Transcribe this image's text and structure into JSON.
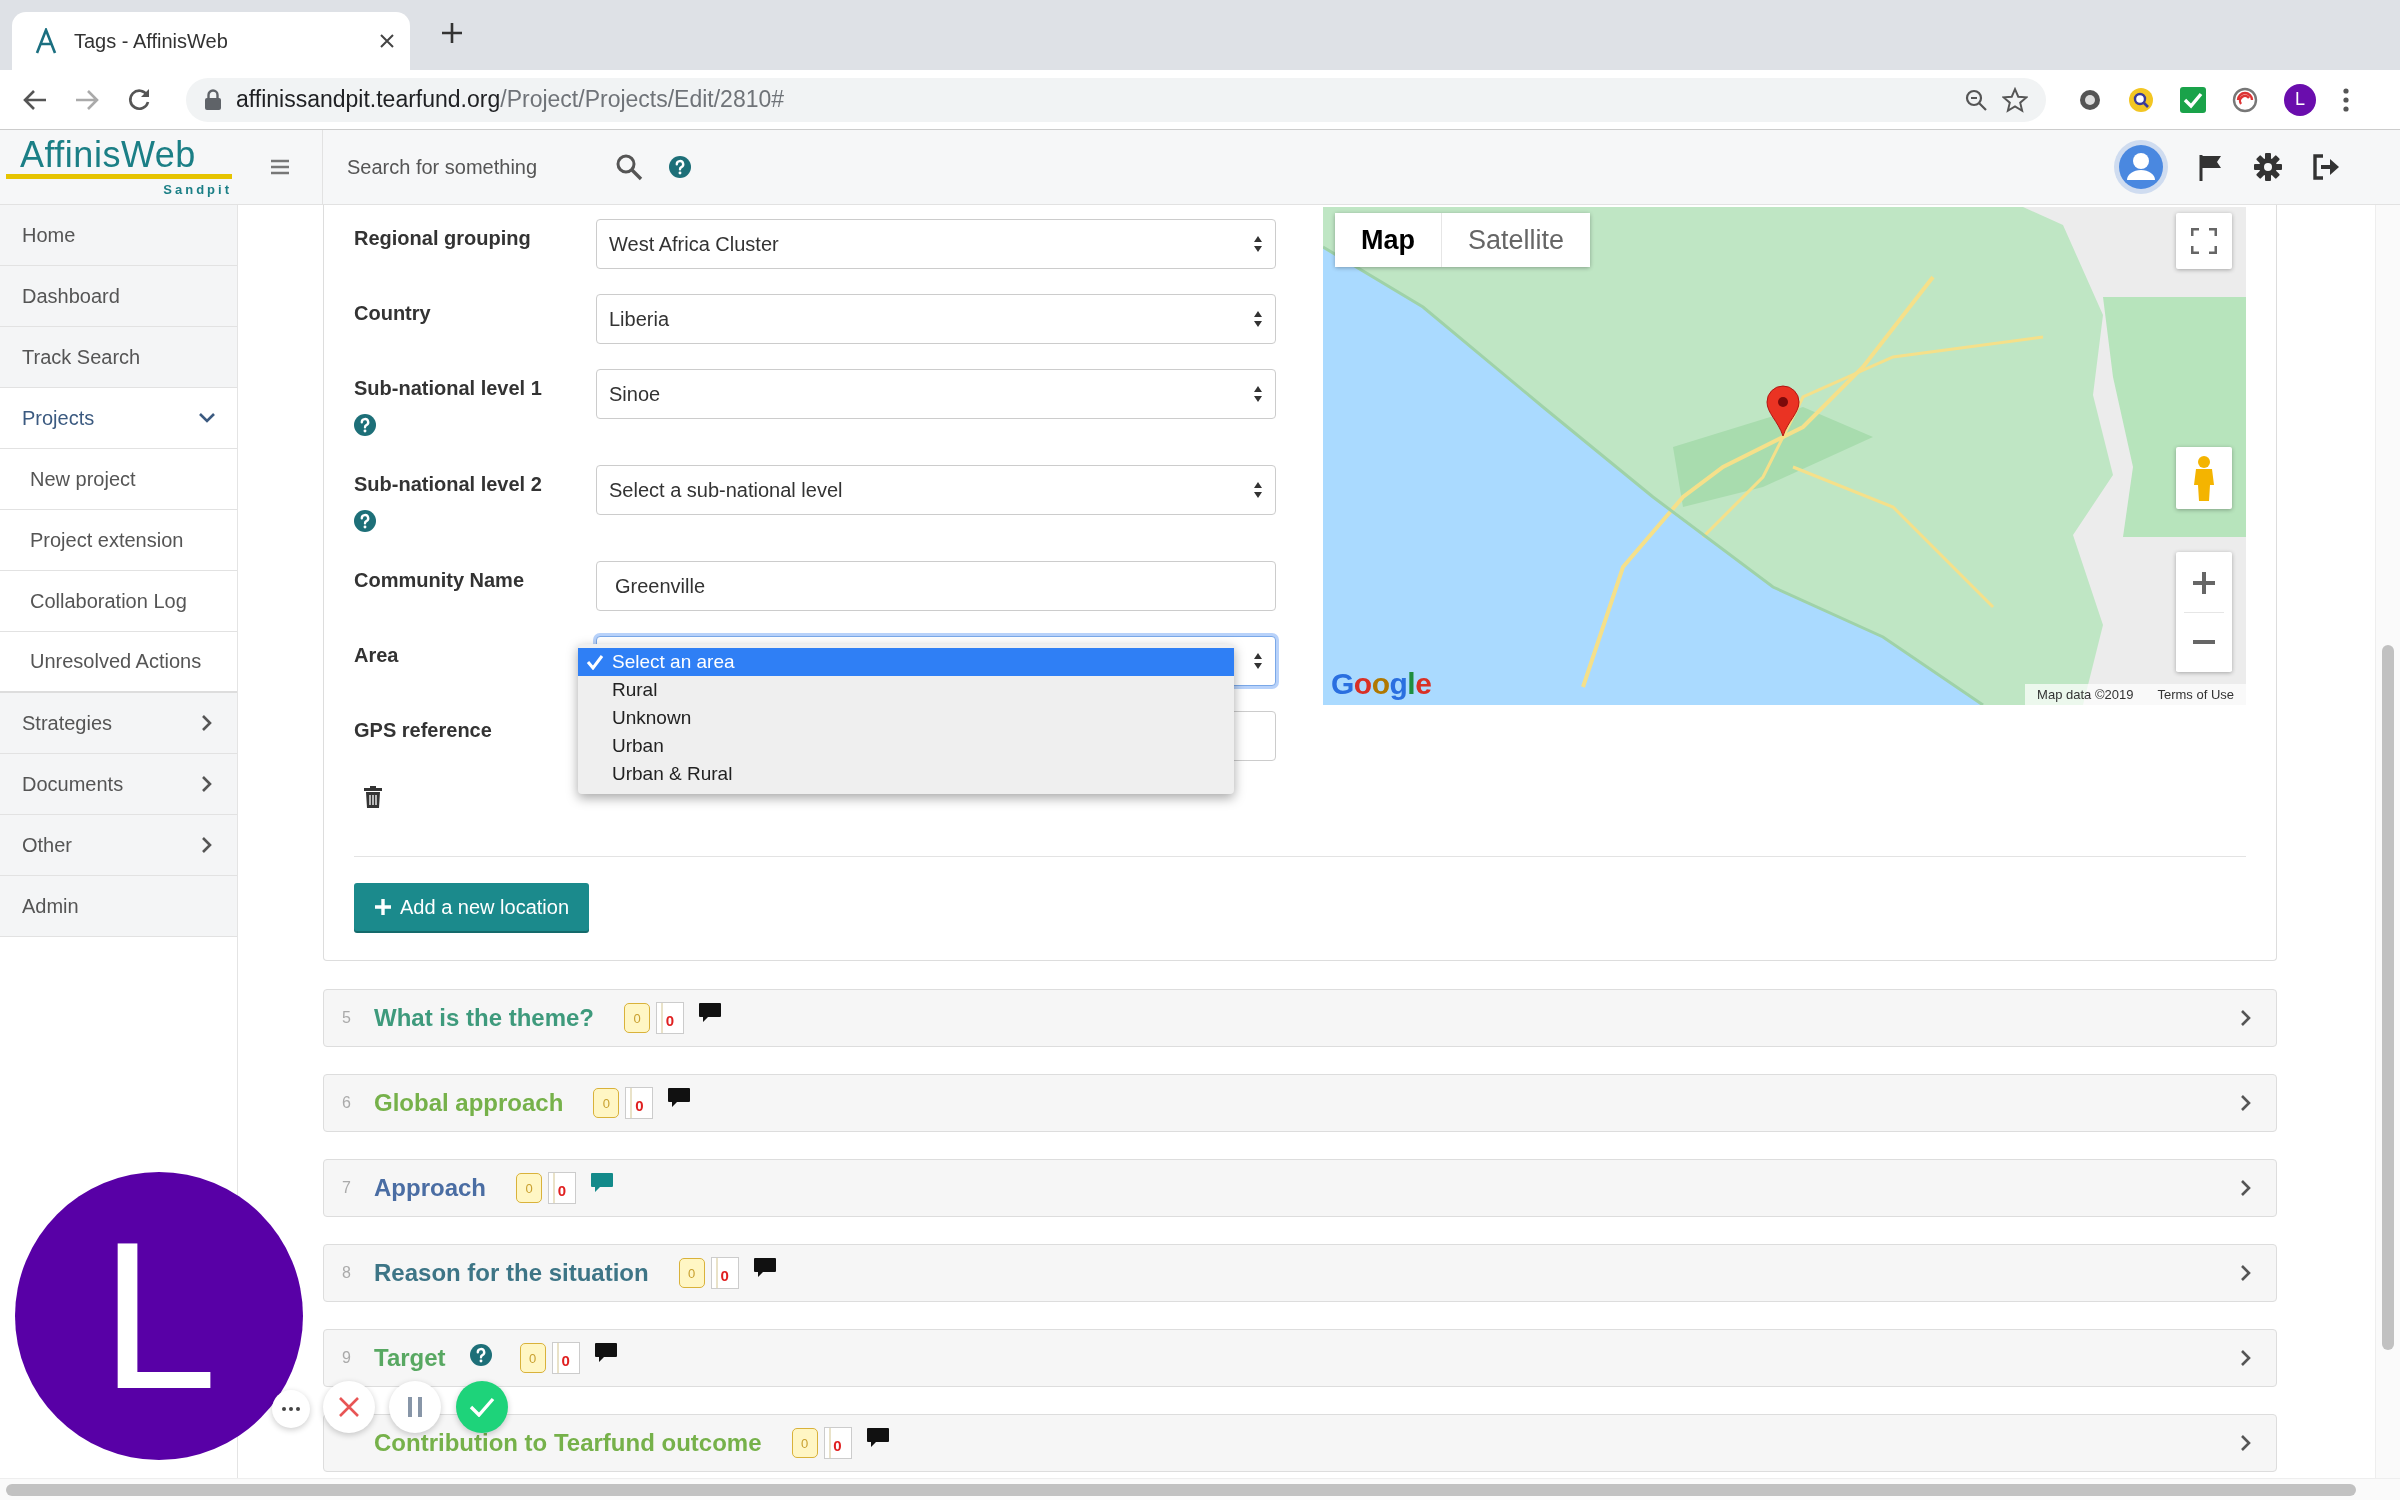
{
  "browser": {
    "tab_title": "Tags - AffinisWeb",
    "url_host": "affinissandpit.tearfund.org",
    "url_path": "/Project/Projects/Edit/2810#",
    "profile_initial": "L"
  },
  "header": {
    "logo": "AffinisWeb",
    "logo_subtitle": "Sandpit",
    "search": {
      "placeholder": "Search for something"
    }
  },
  "sidebar": {
    "items": [
      {
        "label": "Home",
        "kind": "link"
      },
      {
        "label": "Dashboard",
        "kind": "link"
      },
      {
        "label": "Track Search",
        "kind": "link"
      },
      {
        "label": "Projects",
        "kind": "group",
        "expanded": true,
        "children": [
          {
            "label": "New project"
          },
          {
            "label": "Project extension"
          },
          {
            "label": "Collaboration Log"
          },
          {
            "label": "Unresolved Actions"
          }
        ]
      },
      {
        "label": "Strategies",
        "kind": "group",
        "expanded": false
      },
      {
        "label": "Documents",
        "kind": "group",
        "expanded": false
      },
      {
        "label": "Other",
        "kind": "group",
        "expanded": false
      },
      {
        "label": "Admin",
        "kind": "link"
      }
    ]
  },
  "location_form": {
    "fields": [
      {
        "label": "Regional grouping",
        "kind": "select",
        "value": "West Africa Cluster",
        "help": false
      },
      {
        "label": "Country",
        "kind": "select",
        "value": "Liberia",
        "help": false
      },
      {
        "label": "Sub-national level 1",
        "kind": "select",
        "value": "Sinoe",
        "help": true
      },
      {
        "label": "Sub-national level 2",
        "kind": "select",
        "value": "Select a sub-national level",
        "help": true
      },
      {
        "label": "Community Name",
        "kind": "text",
        "value": "Greenville",
        "help": false
      },
      {
        "label": "Area",
        "kind": "select",
        "help": false,
        "open": true,
        "options": [
          {
            "label": "Select an area",
            "selected": true
          },
          {
            "label": "Rural",
            "selected": false
          },
          {
            "label": "Unknown",
            "selected": false
          },
          {
            "label": "Urban",
            "selected": false
          },
          {
            "label": "Urban & Rural",
            "selected": false
          }
        ]
      },
      {
        "label": "GPS reference",
        "kind": "text",
        "help": false
      }
    ],
    "add_button": "Add a new location"
  },
  "map": {
    "kind": "picture",
    "types": [
      {
        "label": "Map",
        "selected": true
      },
      {
        "label": "Satellite",
        "selected": false
      }
    ],
    "logo": "Google",
    "attribution": "Map data ©2019",
    "terms": "Terms of Use"
  },
  "sections": [
    {
      "number": "5",
      "title": "What is the theme?",
      "color": "#3e9a7c",
      "help": false,
      "tag_count": "0",
      "doc_count": "0",
      "comment": {
        "color": "#111111"
      }
    },
    {
      "number": "6",
      "title": "Global approach",
      "color": "#76b14a",
      "help": false,
      "tag_count": "0",
      "doc_count": "0",
      "comment": {
        "color": "#111111"
      }
    },
    {
      "number": "7",
      "title": "Approach",
      "color": "#4a6da3",
      "help": false,
      "tag_count": "0",
      "doc_count": "0",
      "comment": {
        "color": "#138a8a"
      }
    },
    {
      "number": "8",
      "title": "Reason for the situation",
      "color": "#3d7586",
      "help": false,
      "tag_count": "0",
      "doc_count": "0",
      "comment": {
        "color": "#111111"
      }
    },
    {
      "number": "9",
      "title": "Target",
      "color": "#58a862",
      "help": true,
      "tag_count": "0",
      "doc_count": "0",
      "comment": {
        "color": "#111111"
      }
    },
    {
      "title": "Contribution to Tearfund outcome",
      "color": "#76b14a",
      "help": false,
      "tag_count": "0",
      "doc_count": "0",
      "comment": {
        "color": "#111111"
      }
    }
  ],
  "recorder": {
    "avatar_initial": "L"
  }
}
